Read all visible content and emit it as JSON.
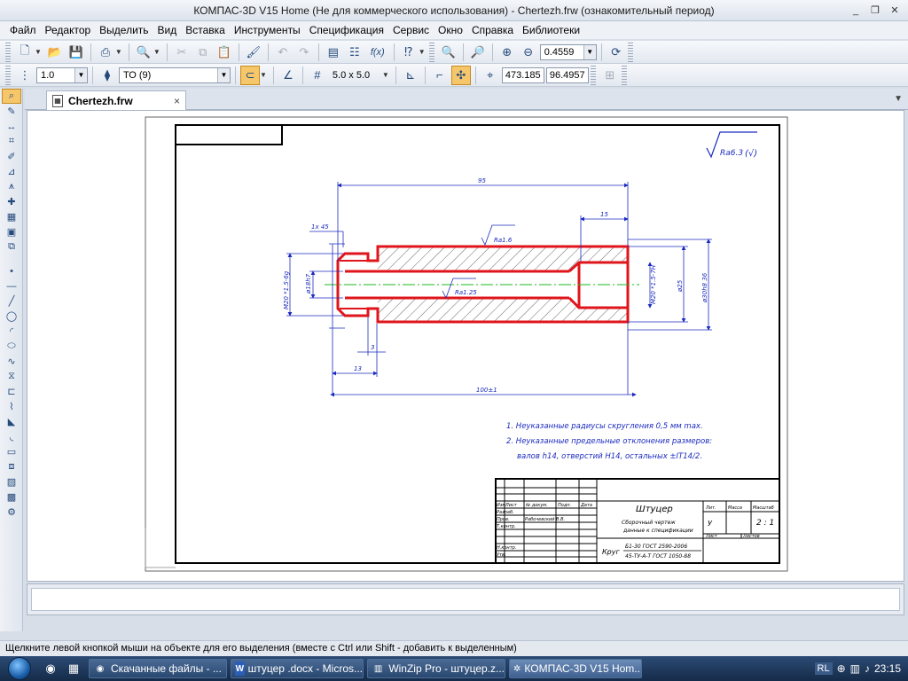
{
  "window": {
    "title": "КОМПАС-3D V15 Home (Не для коммерческого использования) - Chertezh.frw (ознакомительный период)",
    "minimize": "_",
    "restore": "❐",
    "close": "✕"
  },
  "menu": [
    "Файл",
    "Редактор",
    "Выделить",
    "Вид",
    "Вставка",
    "Инструменты",
    "Спецификация",
    "Сервис",
    "Окно",
    "Справка",
    "Библиотеки"
  ],
  "toolbar1": {
    "zoom_value": "0.4559",
    "fx_label": "f(x)"
  },
  "toolbar2": {
    "line_width": "1.0",
    "layer": "ТО (9)",
    "grid_step": "5.0 x 5.0",
    "coord_x": "473.185",
    "coord_y": "96.4957"
  },
  "document_tab": {
    "name": "Chertezh.frw",
    "close": "×"
  },
  "drawing": {
    "roughness_general": "Ra6.3",
    "roughness_check": "(√)",
    "dim_overall_top": "95",
    "dim_bore_depth": "15",
    "dim_chamfer": "1х 45",
    "roughness_outer": "Ra1.6",
    "roughness_bore": "Ra1.25",
    "thread_left": "M20 *1.5-6g",
    "dim_groove_dia": "ø18h7",
    "thread_right": "M20 *1.5-7H",
    "dim_bore_dia": "ø25",
    "dim_outer_dia": "ø30h8 36",
    "dim_groove_width": "3",
    "dim_left_length": "13",
    "dim_total_length": "100±1",
    "note1": "1. Неуказанные радиусы скругления 0,5 мм max.",
    "note2": "2. Неуказанные предельные отклонения размеров:",
    "note3": "валов h14, отверстий H14, остальных ±IT14/2.",
    "titleblock": {
      "name": "Штуцер",
      "subtitle1": "Сборочный чертеж",
      "subtitle2": "данные к спецификации",
      "material1": "Б1-30 ГОСТ 2590-2006",
      "material2": "45-ТУ-А-Т ГОСТ 1050-88",
      "material_label": "Круг",
      "scale": "2 : 1",
      "lit": "Лит.",
      "mass": "Масса",
      "masshtab": "Масштаб",
      "list": "Лист",
      "listov": "Листов",
      "letter": "У",
      "col_izm": "Изм",
      "col_list": "Лист",
      "col_doc": "№ докум.",
      "col_podp": "Подп.",
      "col_date": "Дата",
      "razrab": "Разраб.",
      "prov": "Пров.",
      "tkontr": "Т.контр.",
      "nkontr": "Н.контр.",
      "utv": "Утв.",
      "checker": "Рабочевский В.В."
    }
  },
  "status": "Щелкните левой кнопкой мыши на объекте для его выделения (вместе с Ctrl или Shift - добавить к выделенным)",
  "taskbar": {
    "items": [
      {
        "label": "Скачанные файлы - ..."
      },
      {
        "label": "штуцер .docx - Micros..."
      },
      {
        "label": "WinZip Pro - штуцер.z..."
      },
      {
        "label": "КОМПАС-3D V15 Hom..."
      }
    ],
    "lang": "RL",
    "time": "23:15"
  },
  "colors": {
    "part_outline": "#e0151b",
    "centerline": "#1db81d",
    "dimension": "#1b2bbf"
  }
}
